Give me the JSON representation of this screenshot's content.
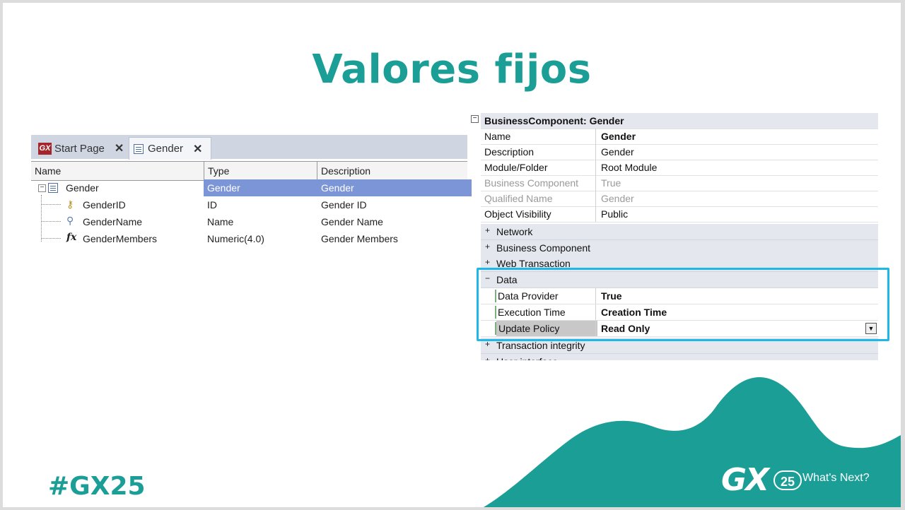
{
  "slide": {
    "title": "Valores fijos",
    "hashtag": "#GX25",
    "logo": {
      "gx": "GX",
      "edition": "25",
      "tagline": "What's Next?"
    },
    "colors": {
      "teal": "#1a9e96",
      "highlight_box": "#1fb6e8",
      "selected_row": "#7b95d6"
    }
  },
  "editor": {
    "tabs": [
      {
        "label": "Start Page",
        "icon": "gx-logo-icon"
      },
      {
        "label": "Gender",
        "icon": "grid-icon",
        "active": true
      }
    ],
    "columns": [
      "Name",
      "Type",
      "Description"
    ],
    "rows": [
      {
        "name": "Gender",
        "type": "Gender",
        "description": "Gender",
        "icon": "grid-icon",
        "selected": true
      },
      {
        "name": "GenderID",
        "type": "ID",
        "description": "Gender ID",
        "icon": "key-icon"
      },
      {
        "name": "GenderName",
        "type": "Name",
        "description": "Gender Name",
        "icon": "search-icon"
      },
      {
        "name": "GenderMembers",
        "type": "Numeric(4.0)",
        "description": "Gender Members",
        "icon": "formula-icon"
      }
    ]
  },
  "properties": {
    "header": "BusinessComponent: Gender",
    "items": [
      {
        "name": "Name",
        "value": "Gender"
      },
      {
        "name": "Description",
        "value": "Gender"
      },
      {
        "name": "Module/Folder",
        "value": "Root Module"
      },
      {
        "name": "Business Component",
        "value": "True"
      },
      {
        "name": "Qualified Name",
        "value": "Gender"
      },
      {
        "name": "Object Visibility",
        "value": "Public"
      }
    ],
    "groups": [
      "Network",
      "Business Component",
      "Web Transaction",
      "Data"
    ],
    "data_items": [
      {
        "name": "Data Provider",
        "value": "True"
      },
      {
        "name": "Execution Time",
        "value": "Creation Time"
      },
      {
        "name": "Update Policy",
        "value": "Read Only"
      }
    ],
    "more_groups": [
      "Transaction integrity",
      "User interface"
    ]
  }
}
